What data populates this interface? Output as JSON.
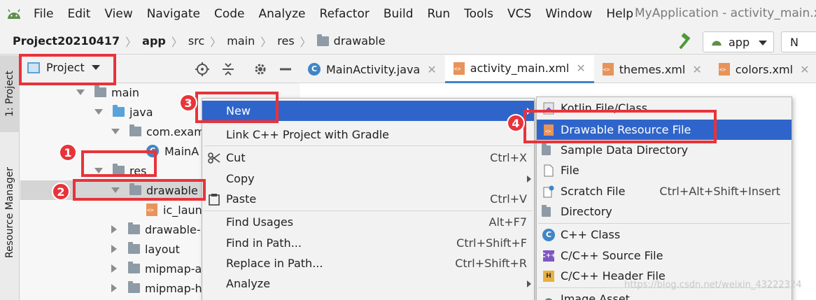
{
  "menubar": {
    "items": [
      "File",
      "Edit",
      "View",
      "Navigate",
      "Code",
      "Analyze",
      "Refactor",
      "Build",
      "Run",
      "Tools",
      "VCS",
      "Window",
      "Help"
    ],
    "title": "MyApplication - activity_main.xml"
  },
  "navbar": {
    "crumbs": [
      "Project20210417",
      "app",
      "src",
      "main",
      "res",
      "drawable"
    ],
    "config": "app",
    "device": "N"
  },
  "leftstrip": {
    "project_tab": "1: Project",
    "resource_tab": "Resource Manager"
  },
  "project_panel": {
    "view_selector": "Project"
  },
  "tree": {
    "rows": [
      "main",
      "java",
      "com.exam",
      "MainA",
      "res",
      "drawable",
      "ic_laun",
      "drawable-",
      "layout",
      "mipmap-a",
      "mipmap-h"
    ]
  },
  "tabs": [
    {
      "label": "MainActivity.java"
    },
    {
      "label": "activity_main.xml"
    },
    {
      "label": "themes.xml"
    },
    {
      "label": "colors.xml"
    }
  ],
  "context_menu": {
    "items": [
      {
        "label": "New",
        "shortcut": ""
      },
      {
        "label": "Link C++ Project with Gradle",
        "shortcut": ""
      },
      {
        "label": "Cut",
        "shortcut": "Ctrl+X"
      },
      {
        "label": "Copy",
        "shortcut": ""
      },
      {
        "label": "Paste",
        "shortcut": "Ctrl+V"
      },
      {
        "label": "Find Usages",
        "shortcut": "Alt+F7"
      },
      {
        "label": "Find in Path...",
        "shortcut": "Ctrl+Shift+F"
      },
      {
        "label": "Replace in Path...",
        "shortcut": "Ctrl+Shift+R"
      },
      {
        "label": "Analyze",
        "shortcut": ""
      }
    ]
  },
  "submenu": {
    "items": [
      {
        "label": "Kotlin File/Class",
        "shortcut": ""
      },
      {
        "label": "Drawable Resource File",
        "shortcut": ""
      },
      {
        "label": "Sample Data Directory",
        "shortcut": ""
      },
      {
        "label": "File",
        "shortcut": ""
      },
      {
        "label": "Scratch File",
        "shortcut": "Ctrl+Alt+Shift+Insert"
      },
      {
        "label": "Directory",
        "shortcut": ""
      },
      {
        "label": "C++ Class",
        "shortcut": ""
      },
      {
        "label": "C/C++ Source File",
        "shortcut": ""
      },
      {
        "label": "C/C++ Header File",
        "shortcut": ""
      },
      {
        "label": "Image Asset",
        "shortcut": ""
      }
    ]
  },
  "markers": [
    "1",
    "2",
    "3",
    "4"
  ],
  "watermark": "https://blog.csdn.net/weixin_43222324",
  "colors": {
    "highlight": "#2f65ca",
    "annotation_red": "#e8333a",
    "tab_underline": "#4083c9"
  }
}
